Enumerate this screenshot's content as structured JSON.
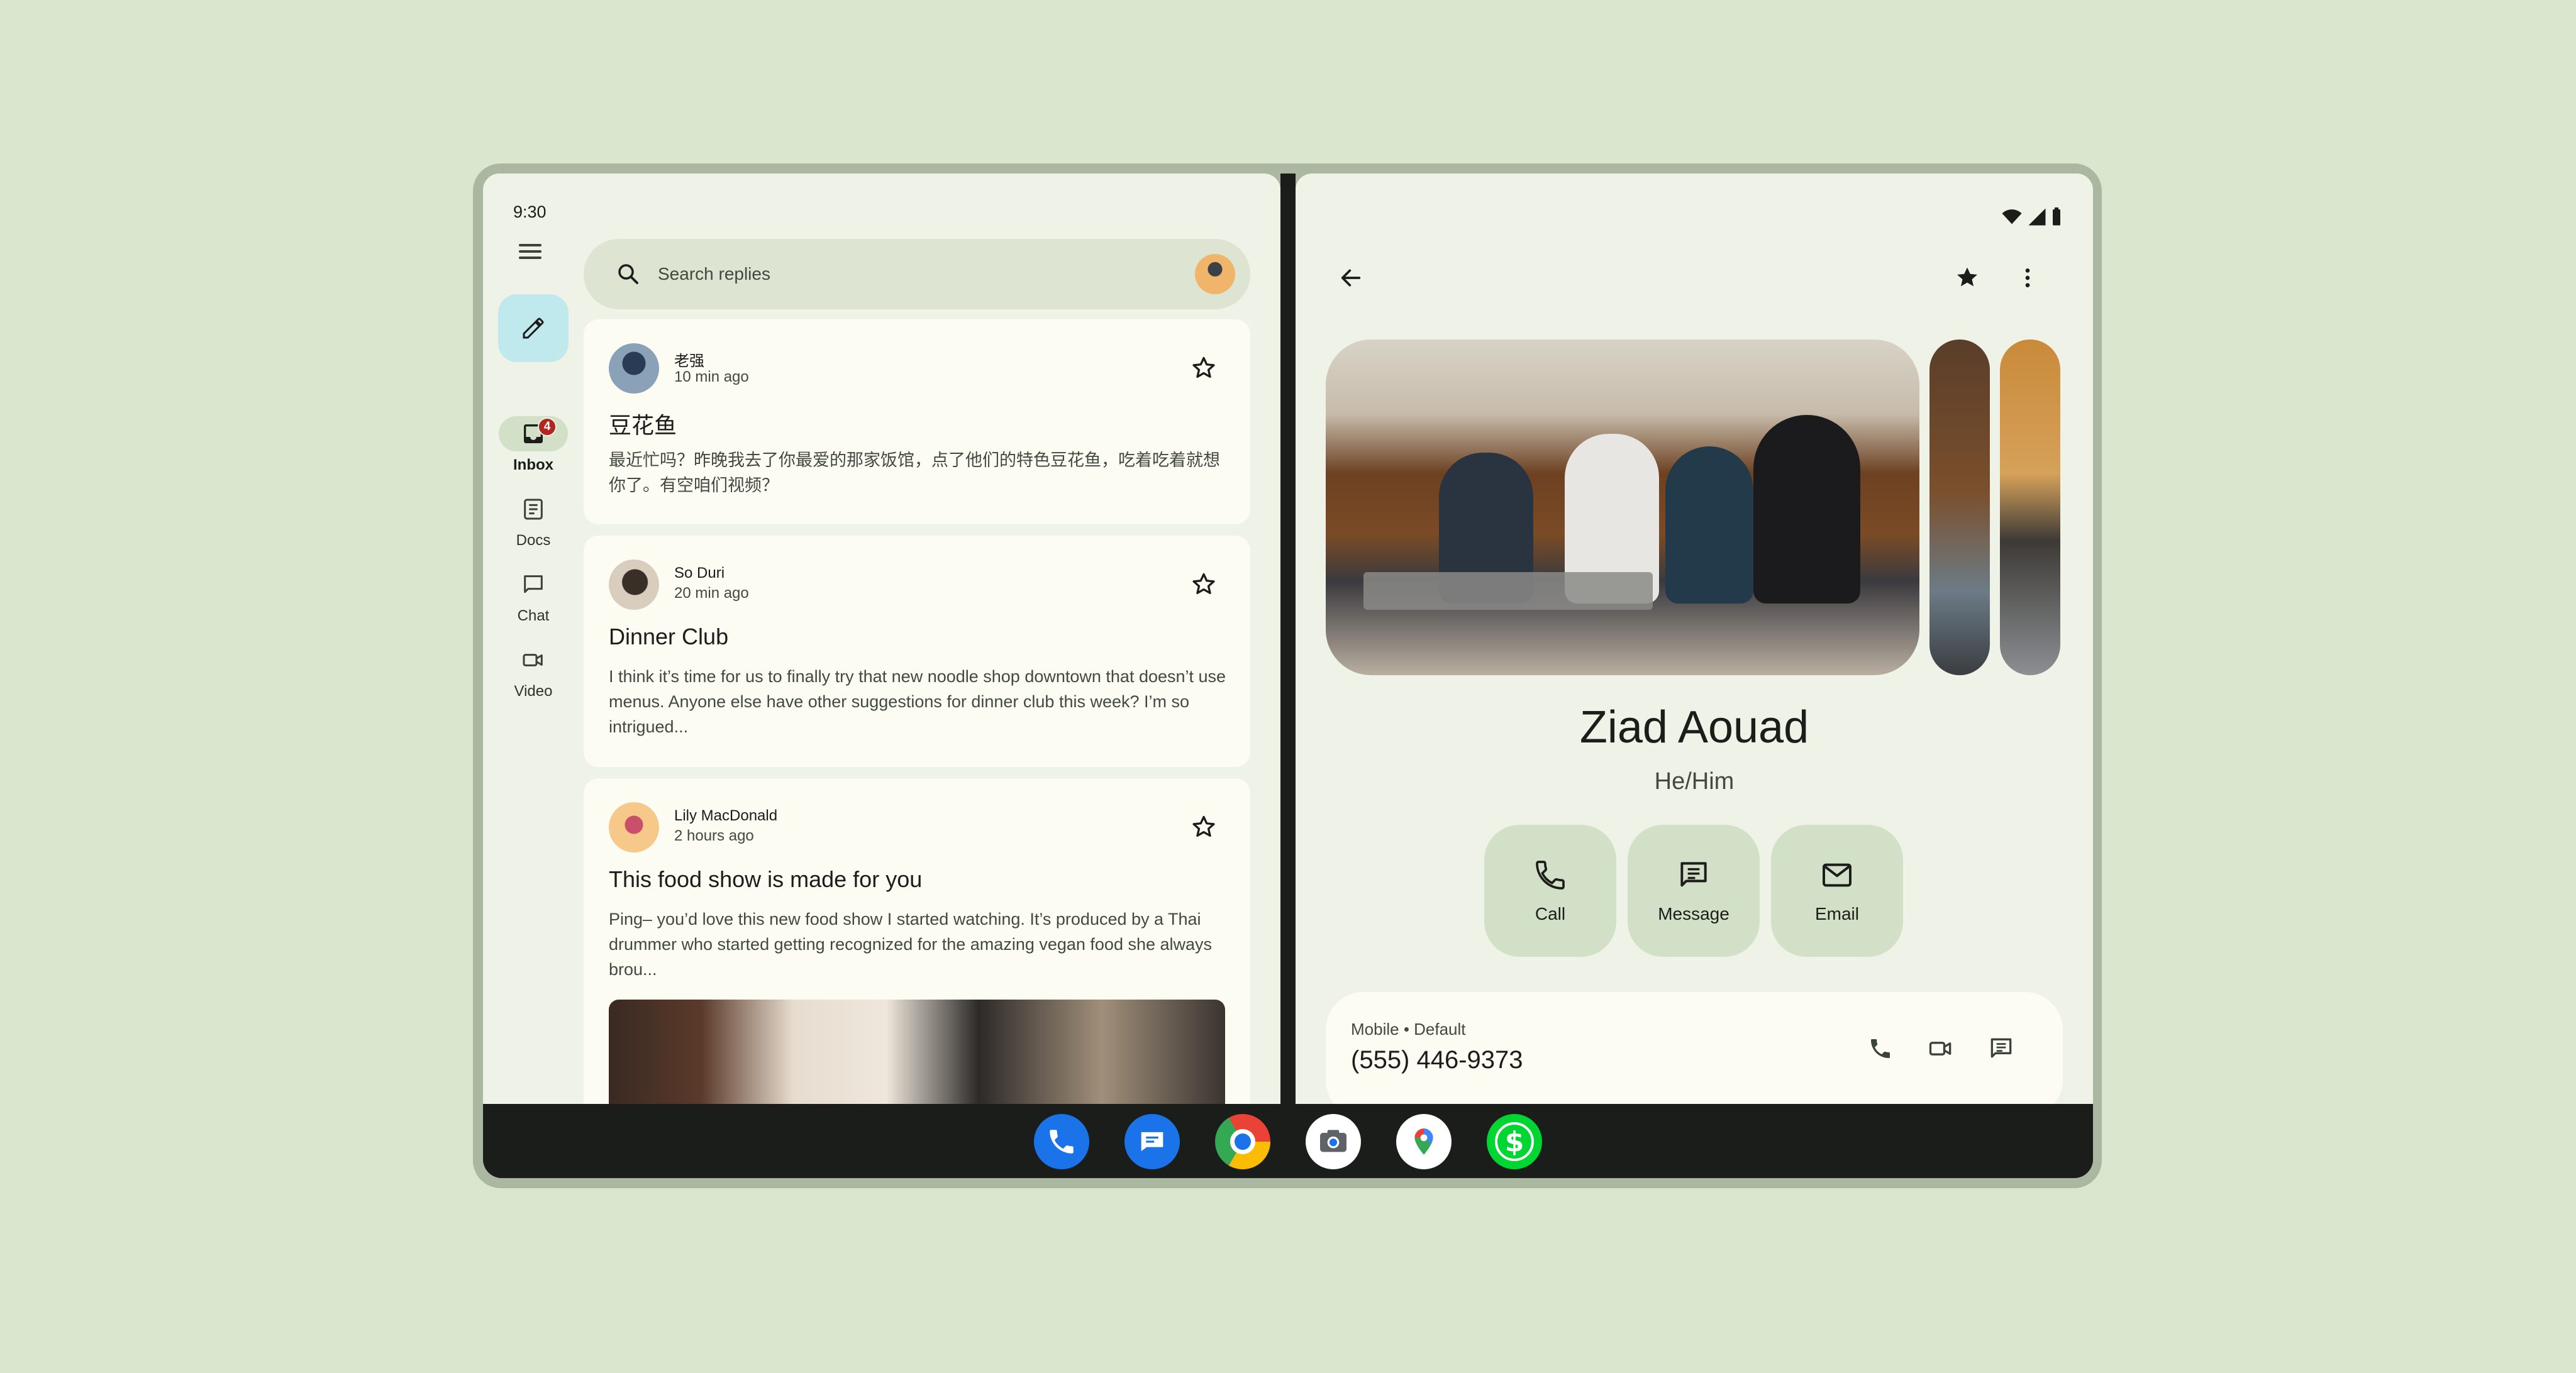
{
  "status": {
    "time": "9:30"
  },
  "nav": {
    "items": [
      {
        "label": "Inbox",
        "badge": "4"
      },
      {
        "label": "Docs"
      },
      {
        "label": "Chat"
      },
      {
        "label": "Video"
      }
    ]
  },
  "search": {
    "placeholder": "Search replies"
  },
  "messages": [
    {
      "sender": "老强",
      "time": "10 min ago",
      "subject": "豆花鱼",
      "body": "最近忙吗？昨晚我去了你最爱的那家饭馆，点了他们的特色豆花鱼，吃着吃着就想你了。有空咱们视频？"
    },
    {
      "sender": "So Duri",
      "time": "20 min ago",
      "subject": "Dinner Club",
      "body": "I think it’s time for us to finally try that new noodle shop downtown that doesn’t use menus. Anyone else have other suggestions for dinner club this week? I’m so intrigued..."
    },
    {
      "sender": "Lily MacDonald",
      "time": "2 hours ago",
      "subject": "This food show is made for you",
      "body": "Ping– you’d love this new food show I started watching. It’s produced by a Thai drummer who started getting recognized for the amazing vegan food she always brou..."
    }
  ],
  "contact": {
    "name": "Ziad Aouad",
    "pronouns": "He/Him",
    "actions": [
      {
        "label": "Call"
      },
      {
        "label": "Message"
      },
      {
        "label": "Email"
      }
    ],
    "phone": {
      "meta": "Mobile • Default",
      "number": "(555) 446-9373"
    }
  },
  "icons": {
    "menu": "menu-icon",
    "compose": "pencil-icon",
    "inbox": "inbox-icon",
    "docs": "docs-icon",
    "chat": "chat-icon",
    "video": "video-icon",
    "search": "search-icon",
    "star": "star-outline-icon",
    "back": "arrow-back-icon",
    "favorite": "star-filled-icon",
    "more": "more-vert-icon",
    "wifi": "wifi-icon",
    "signal": "signal-icon",
    "battery": "battery-icon"
  },
  "dock": [
    "phone-app",
    "messages-app",
    "chrome-app",
    "camera-app",
    "maps-app",
    "cash-app"
  ],
  "colors": {
    "background": "#dae6cd",
    "surface": "#eff2e7",
    "card": "#fdfcf2",
    "tonal": "#d3e0c8",
    "fab": "#bfe9ec",
    "badge": "#b3261e",
    "dock": "#1b1d1a"
  }
}
